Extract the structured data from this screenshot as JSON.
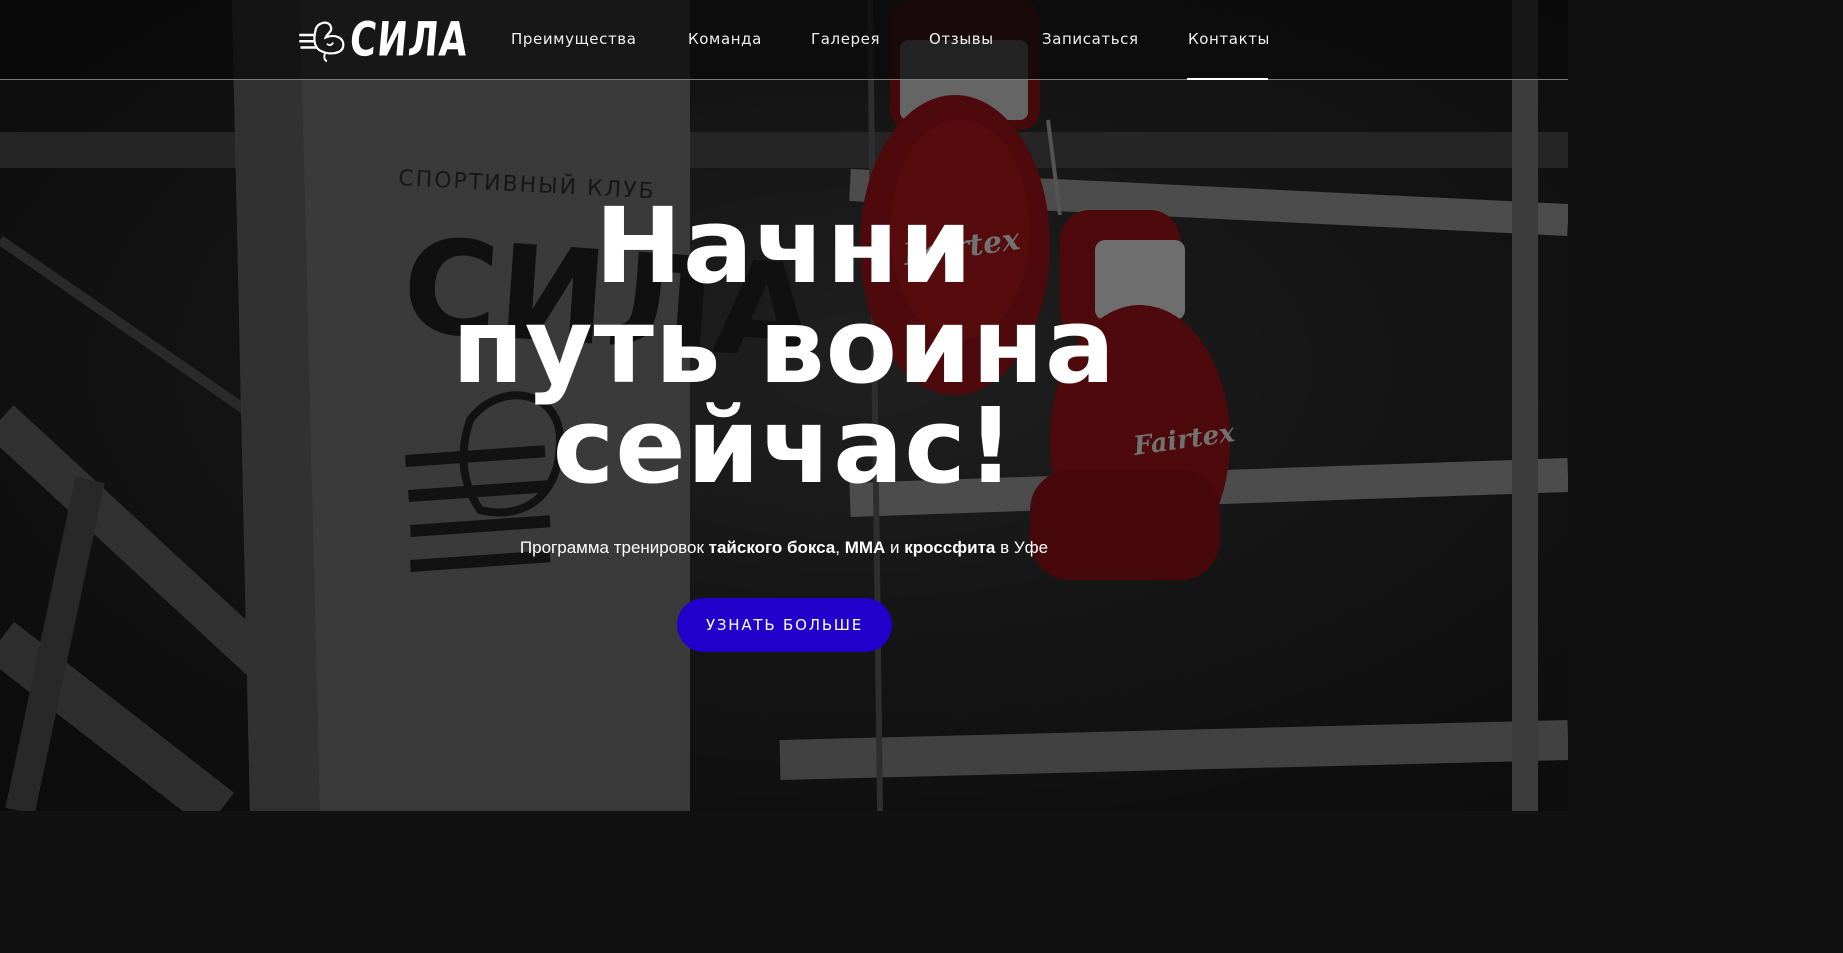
{
  "header": {
    "logo_text": "СИЛА",
    "nav": [
      {
        "label": "Преимущества"
      },
      {
        "label": "Команда"
      },
      {
        "label": "Галерея"
      },
      {
        "label": "Отзывы"
      },
      {
        "label": "Записаться"
      },
      {
        "label": "Контакты",
        "active": true
      }
    ]
  },
  "hero": {
    "title_lines": [
      "Начни",
      "путь воина",
      "сейчас!"
    ],
    "subtitle": {
      "part1": "Программа тренировок ",
      "bold1": "тайского бокса",
      "sep1": ", ",
      "bold2": "ММА",
      "part2": " и ",
      "bold3": "кроссфита",
      "part3": " в Уфе"
    },
    "cta_label": "УЗНАТЬ БОЛЬШЕ"
  },
  "background": {
    "banner_caption": "СПОРТИВНЫЙ КЛУБ",
    "banner_logo": "СИЛА",
    "glove_brand": "Fairtex"
  },
  "colors": {
    "accent": "#2200cc",
    "glove_red": "#b0181c",
    "header_bg": "#0a0a0a"
  }
}
